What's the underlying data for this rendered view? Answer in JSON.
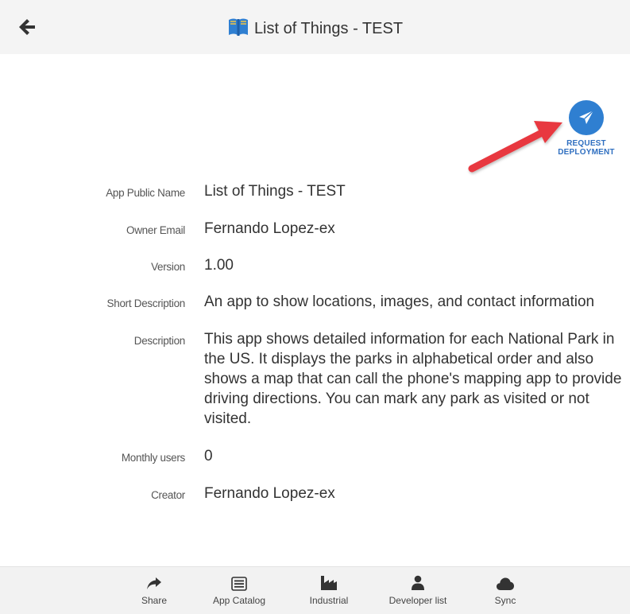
{
  "header": {
    "title": "List of Things - TEST",
    "back_icon": "arrow-left-icon",
    "title_icon": "book-icon"
  },
  "deploy": {
    "icon": "paper-plane-icon",
    "label_line1": "REQUEST",
    "label_line2": "DEPLOYMENT"
  },
  "details": {
    "app_public_name": {
      "label": "App Public Name",
      "value": "List of Things - TEST"
    },
    "owner_email": {
      "label": "Owner Email",
      "value": "Fernando Lopez-ex"
    },
    "version": {
      "label": "Version",
      "value": "1.00"
    },
    "short_description": {
      "label": "Short Description",
      "value": "An app to show locations, images, and contact information"
    },
    "description": {
      "label": "Description",
      "value": "This app shows detailed information for each National Park in the US. It displays the parks in alphabetical order and also shows a map that can call the phone's mapping app to provide driving directions. You can mark any park as visited or not visited."
    },
    "monthly_users": {
      "label": "Monthly users",
      "value": "0"
    },
    "creator": {
      "label": "Creator",
      "value": "Fernando Lopez-ex"
    }
  },
  "bottom_nav": {
    "share": "Share",
    "app_catalog": "App Catalog",
    "industrial": "Industrial",
    "developer_list": "Developer list",
    "sync": "Sync"
  },
  "colors": {
    "header_bg": "#f4f4f4",
    "accent_blue": "#2f7fd1",
    "annotation_red": "#e8393f",
    "nav_bg": "#f2f2f2"
  }
}
